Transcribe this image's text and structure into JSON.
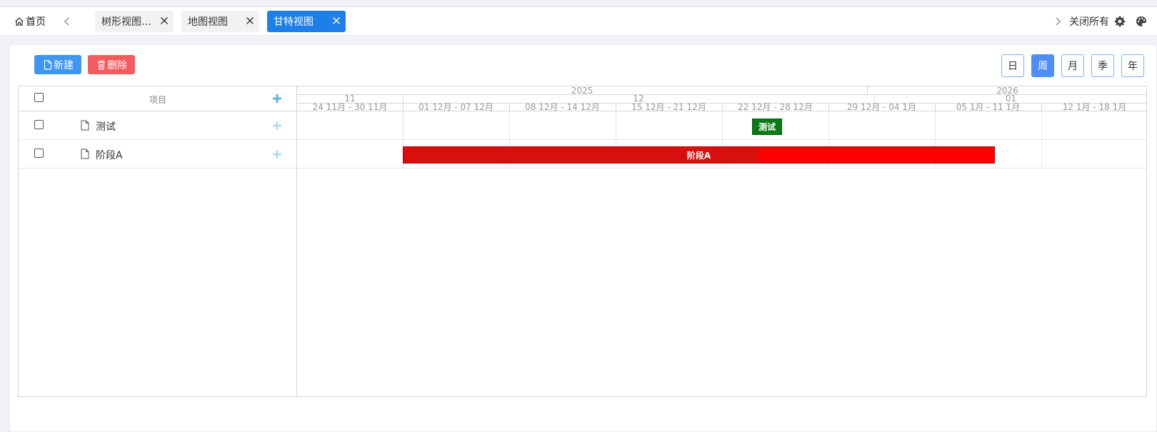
{
  "tabbar": {
    "home_label": "首页",
    "tabs": [
      {
        "label": "树形视图_..."
      },
      {
        "label": "地图视图"
      },
      {
        "label": "甘特视图"
      }
    ],
    "close_all_label": "关闭所有"
  },
  "toolbar": {
    "new_label": "新建",
    "delete_label": "删除",
    "views": [
      "日",
      "周",
      "月",
      "季",
      "年"
    ],
    "active_view": "周"
  },
  "grid": {
    "column_header": "项目",
    "rows": [
      {
        "name": "测试"
      },
      {
        "name": "阶段A"
      }
    ]
  },
  "timeline": {
    "years": [
      "2025",
      "2026"
    ],
    "months": [
      "11",
      "12",
      "01"
    ],
    "weeks": [
      "24 11月 - 30 11月",
      "01 12月 - 07 12月",
      "08 12月 - 14 12月",
      "15 12月 - 21 12月",
      "22 12月 - 28 12月",
      "29 12月 - 04 1月",
      "05 1月 - 11 1月",
      "12 1月 - 18 1月"
    ]
  },
  "tasks": [
    {
      "name": "测试",
      "color": "#0b7a16"
    },
    {
      "name": "阶段A",
      "color": "#ff0000",
      "progress_color": "#d90f0f"
    }
  ],
  "colors": {
    "primary": "#1e7fe8",
    "new_button": "#3d96f2",
    "delete_button": "#f45b5e"
  }
}
